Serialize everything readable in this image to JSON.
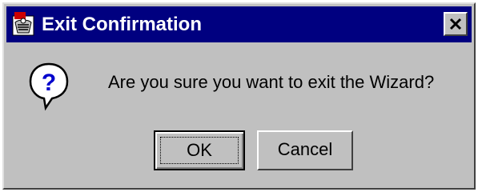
{
  "window": {
    "title": "Exit Confirmation",
    "app_icon": "app-logo-icon",
    "close_icon": "close-icon",
    "title_bar_color": "#000080"
  },
  "dialog": {
    "icon": "question-icon",
    "message": "Are you sure you want to exit the Wizard?"
  },
  "buttons": {
    "ok_label": "OK",
    "cancel_label": "Cancel",
    "default": "OK"
  }
}
